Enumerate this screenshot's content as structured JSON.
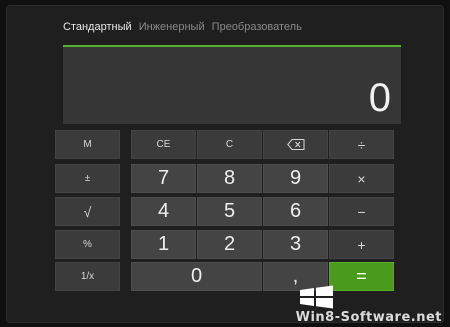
{
  "tabs": [
    {
      "label": "Стандартный",
      "active": true
    },
    {
      "label": "Инженерный",
      "active": false
    },
    {
      "label": "Преобразователь",
      "active": false
    }
  ],
  "display": {
    "value": "0"
  },
  "keys": {
    "m": "M",
    "plusminus": "±",
    "sqrt": "√",
    "percent": "%",
    "reciprocal": "1/x",
    "ce": "CE",
    "c": "C",
    "divide": "÷",
    "multiply": "×",
    "minus": "−",
    "plus": "+",
    "equals": "=",
    "d7": "7",
    "d8": "8",
    "d9": "9",
    "d4": "4",
    "d5": "5",
    "d6": "6",
    "d1": "1",
    "d2": "2",
    "d3": "3",
    "d0": "0",
    "comma": ","
  },
  "icons": {
    "backspace": "backspace-icon",
    "windows_logo": "windows-logo-icon"
  },
  "colors": {
    "accent_green": "#55b02f",
    "equals_button": "#4a9a1c",
    "display_bg": "#363636",
    "key_bg": "#3b3b3b"
  },
  "watermark": {
    "text": "Win8-Software.net"
  }
}
